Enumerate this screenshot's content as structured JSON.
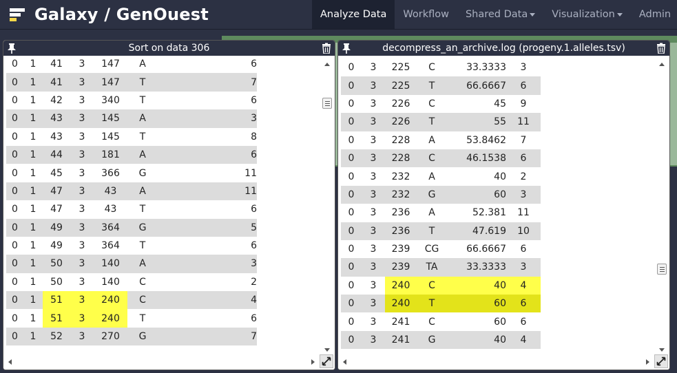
{
  "app": {
    "brand": "Galaxy / GenOuest"
  },
  "nav": {
    "items": [
      {
        "label": "Analyze Data",
        "active": true,
        "dropdown": false
      },
      {
        "label": "Workflow",
        "active": false,
        "dropdown": false
      },
      {
        "label": "Shared Data",
        "active": false,
        "dropdown": true
      },
      {
        "label": "Visualization",
        "active": false,
        "dropdown": true
      },
      {
        "label": "Admin",
        "active": false,
        "dropdown": false
      }
    ]
  },
  "colors": {
    "navbar": "#2c3143",
    "highlight": "#ffff4a",
    "highlight_dark": "#e3e31a",
    "row_alt": "#dcdcdc"
  },
  "left_frame": {
    "title": "Sort on data 306",
    "icons": [
      "pin-icon",
      "trash-icon"
    ],
    "rows": [
      [
        "0",
        "1",
        "41",
        "3",
        "147",
        "A",
        "6"
      ],
      [
        "0",
        "1",
        "41",
        "3",
        "147",
        "T",
        "7"
      ],
      [
        "0",
        "1",
        "42",
        "3",
        "340",
        "T",
        "6"
      ],
      [
        "0",
        "1",
        "43",
        "3",
        "145",
        "A",
        "3"
      ],
      [
        "0",
        "1",
        "43",
        "3",
        "145",
        "T",
        "8"
      ],
      [
        "0",
        "1",
        "44",
        "3",
        "181",
        "A",
        "6"
      ],
      [
        "0",
        "1",
        "45",
        "3",
        "366",
        "G",
        "11"
      ],
      [
        "0",
        "1",
        "47",
        "3",
        "43",
        "A",
        "11"
      ],
      [
        "0",
        "1",
        "47",
        "3",
        "43",
        "T",
        "6"
      ],
      [
        "0",
        "1",
        "49",
        "3",
        "364",
        "G",
        "5"
      ],
      [
        "0",
        "1",
        "49",
        "3",
        "364",
        "T",
        "6"
      ],
      [
        "0",
        "1",
        "50",
        "3",
        "140",
        "A",
        "3"
      ],
      [
        "0",
        "1",
        "50",
        "3",
        "140",
        "C",
        "2"
      ],
      [
        "0",
        "1",
        "51",
        "3",
        "240",
        "C",
        "4"
      ],
      [
        "0",
        "1",
        "51",
        "3",
        "240",
        "T",
        "6"
      ],
      [
        "0",
        "1",
        "52",
        "3",
        "270",
        "G",
        "7"
      ]
    ],
    "highlighted_rows": [
      13,
      14
    ]
  },
  "right_frame": {
    "title": "decompress_an_archive.log (progeny.1.alleles.tsv)",
    "icons": [
      "pin-icon",
      "trash-icon"
    ],
    "rows": [
      [
        "0",
        "3",
        "225",
        "C",
        "33.3333",
        "3"
      ],
      [
        "0",
        "3",
        "225",
        "T",
        "66.6667",
        "6"
      ],
      [
        "0",
        "3",
        "226",
        "C",
        "45",
        "9"
      ],
      [
        "0",
        "3",
        "226",
        "T",
        "55",
        "11"
      ],
      [
        "0",
        "3",
        "228",
        "A",
        "53.8462",
        "7"
      ],
      [
        "0",
        "3",
        "228",
        "C",
        "46.1538",
        "6"
      ],
      [
        "0",
        "3",
        "232",
        "A",
        "40",
        "2"
      ],
      [
        "0",
        "3",
        "232",
        "G",
        "60",
        "3"
      ],
      [
        "0",
        "3",
        "236",
        "A",
        "52.381",
        "11"
      ],
      [
        "0",
        "3",
        "236",
        "T",
        "47.619",
        "10"
      ],
      [
        "0",
        "3",
        "239",
        "CG",
        "66.6667",
        "6"
      ],
      [
        "0",
        "3",
        "239",
        "TA",
        "33.3333",
        "3"
      ],
      [
        "0",
        "3",
        "240",
        "C",
        "40",
        "4"
      ],
      [
        "0",
        "3",
        "240",
        "T",
        "60",
        "6"
      ],
      [
        "0",
        "3",
        "241",
        "C",
        "60",
        "6"
      ],
      [
        "0",
        "3",
        "241",
        "G",
        "40",
        "4"
      ]
    ],
    "highlighted_rows": [
      12,
      13
    ]
  }
}
